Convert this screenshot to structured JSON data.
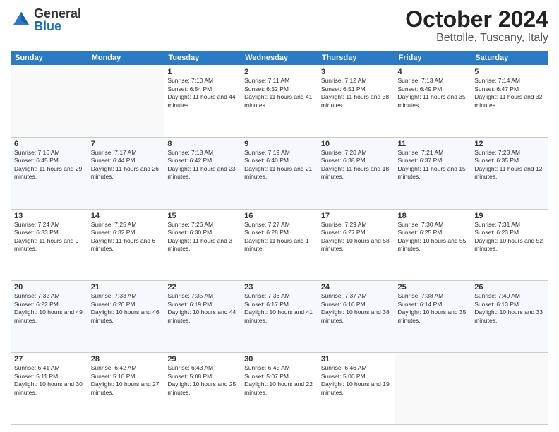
{
  "logo": {
    "general": "General",
    "blue": "Blue"
  },
  "header": {
    "month": "October 2024",
    "location": "Bettolle, Tuscany, Italy"
  },
  "weekdays": [
    "Sunday",
    "Monday",
    "Tuesday",
    "Wednesday",
    "Thursday",
    "Friday",
    "Saturday"
  ],
  "weeks": [
    [
      {
        "day": "",
        "sunrise": "",
        "sunset": "",
        "daylight": ""
      },
      {
        "day": "",
        "sunrise": "",
        "sunset": "",
        "daylight": ""
      },
      {
        "day": "1",
        "sunrise": "Sunrise: 7:10 AM",
        "sunset": "Sunset: 6:54 PM",
        "daylight": "Daylight: 11 hours and 44 minutes."
      },
      {
        "day": "2",
        "sunrise": "Sunrise: 7:11 AM",
        "sunset": "Sunset: 6:52 PM",
        "daylight": "Daylight: 11 hours and 41 minutes."
      },
      {
        "day": "3",
        "sunrise": "Sunrise: 7:12 AM",
        "sunset": "Sunset: 6:51 PM",
        "daylight": "Daylight: 11 hours and 38 minutes."
      },
      {
        "day": "4",
        "sunrise": "Sunrise: 7:13 AM",
        "sunset": "Sunset: 6:49 PM",
        "daylight": "Daylight: 11 hours and 35 minutes."
      },
      {
        "day": "5",
        "sunrise": "Sunrise: 7:14 AM",
        "sunset": "Sunset: 6:47 PM",
        "daylight": "Daylight: 11 hours and 32 minutes."
      }
    ],
    [
      {
        "day": "6",
        "sunrise": "Sunrise: 7:16 AM",
        "sunset": "Sunset: 6:45 PM",
        "daylight": "Daylight: 11 hours and 29 minutes."
      },
      {
        "day": "7",
        "sunrise": "Sunrise: 7:17 AM",
        "sunset": "Sunset: 6:44 PM",
        "daylight": "Daylight: 11 hours and 26 minutes."
      },
      {
        "day": "8",
        "sunrise": "Sunrise: 7:18 AM",
        "sunset": "Sunset: 6:42 PM",
        "daylight": "Daylight: 11 hours and 23 minutes."
      },
      {
        "day": "9",
        "sunrise": "Sunrise: 7:19 AM",
        "sunset": "Sunset: 6:40 PM",
        "daylight": "Daylight: 11 hours and 21 minutes."
      },
      {
        "day": "10",
        "sunrise": "Sunrise: 7:20 AM",
        "sunset": "Sunset: 6:38 PM",
        "daylight": "Daylight: 11 hours and 18 minutes."
      },
      {
        "day": "11",
        "sunrise": "Sunrise: 7:21 AM",
        "sunset": "Sunset: 6:37 PM",
        "daylight": "Daylight: 11 hours and 15 minutes."
      },
      {
        "day": "12",
        "sunrise": "Sunrise: 7:23 AM",
        "sunset": "Sunset: 6:35 PM",
        "daylight": "Daylight: 11 hours and 12 minutes."
      }
    ],
    [
      {
        "day": "13",
        "sunrise": "Sunrise: 7:24 AM",
        "sunset": "Sunset: 6:33 PM",
        "daylight": "Daylight: 11 hours and 9 minutes."
      },
      {
        "day": "14",
        "sunrise": "Sunrise: 7:25 AM",
        "sunset": "Sunset: 6:32 PM",
        "daylight": "Daylight: 11 hours and 6 minutes."
      },
      {
        "day": "15",
        "sunrise": "Sunrise: 7:26 AM",
        "sunset": "Sunset: 6:30 PM",
        "daylight": "Daylight: 11 hours and 3 minutes."
      },
      {
        "day": "16",
        "sunrise": "Sunrise: 7:27 AM",
        "sunset": "Sunset: 6:28 PM",
        "daylight": "Daylight: 11 hours and 1 minute."
      },
      {
        "day": "17",
        "sunrise": "Sunrise: 7:29 AM",
        "sunset": "Sunset: 6:27 PM",
        "daylight": "Daylight: 10 hours and 58 minutes."
      },
      {
        "day": "18",
        "sunrise": "Sunrise: 7:30 AM",
        "sunset": "Sunset: 6:25 PM",
        "daylight": "Daylight: 10 hours and 55 minutes."
      },
      {
        "day": "19",
        "sunrise": "Sunrise: 7:31 AM",
        "sunset": "Sunset: 6:23 PM",
        "daylight": "Daylight: 10 hours and 52 minutes."
      }
    ],
    [
      {
        "day": "20",
        "sunrise": "Sunrise: 7:32 AM",
        "sunset": "Sunset: 6:22 PM",
        "daylight": "Daylight: 10 hours and 49 minutes."
      },
      {
        "day": "21",
        "sunrise": "Sunrise: 7:33 AM",
        "sunset": "Sunset: 6:20 PM",
        "daylight": "Daylight: 10 hours and 46 minutes."
      },
      {
        "day": "22",
        "sunrise": "Sunrise: 7:35 AM",
        "sunset": "Sunset: 6:19 PM",
        "daylight": "Daylight: 10 hours and 44 minutes."
      },
      {
        "day": "23",
        "sunrise": "Sunrise: 7:36 AM",
        "sunset": "Sunset: 6:17 PM",
        "daylight": "Daylight: 10 hours and 41 minutes."
      },
      {
        "day": "24",
        "sunrise": "Sunrise: 7:37 AM",
        "sunset": "Sunset: 6:16 PM",
        "daylight": "Daylight: 10 hours and 38 minutes."
      },
      {
        "day": "25",
        "sunrise": "Sunrise: 7:38 AM",
        "sunset": "Sunset: 6:14 PM",
        "daylight": "Daylight: 10 hours and 35 minutes."
      },
      {
        "day": "26",
        "sunrise": "Sunrise: 7:40 AM",
        "sunset": "Sunset: 6:13 PM",
        "daylight": "Daylight: 10 hours and 33 minutes."
      }
    ],
    [
      {
        "day": "27",
        "sunrise": "Sunrise: 6:41 AM",
        "sunset": "Sunset: 5:11 PM",
        "daylight": "Daylight: 10 hours and 30 minutes."
      },
      {
        "day": "28",
        "sunrise": "Sunrise: 6:42 AM",
        "sunset": "Sunset: 5:10 PM",
        "daylight": "Daylight: 10 hours and 27 minutes."
      },
      {
        "day": "29",
        "sunrise": "Sunrise: 6:43 AM",
        "sunset": "Sunset: 5:08 PM",
        "daylight": "Daylight: 10 hours and 25 minutes."
      },
      {
        "day": "30",
        "sunrise": "Sunrise: 6:45 AM",
        "sunset": "Sunset: 5:07 PM",
        "daylight": "Daylight: 10 hours and 22 minutes."
      },
      {
        "day": "31",
        "sunrise": "Sunrise: 6:46 AM",
        "sunset": "Sunset: 5:06 PM",
        "daylight": "Daylight: 10 hours and 19 minutes."
      },
      {
        "day": "",
        "sunrise": "",
        "sunset": "",
        "daylight": ""
      },
      {
        "day": "",
        "sunrise": "",
        "sunset": "",
        "daylight": ""
      }
    ]
  ]
}
